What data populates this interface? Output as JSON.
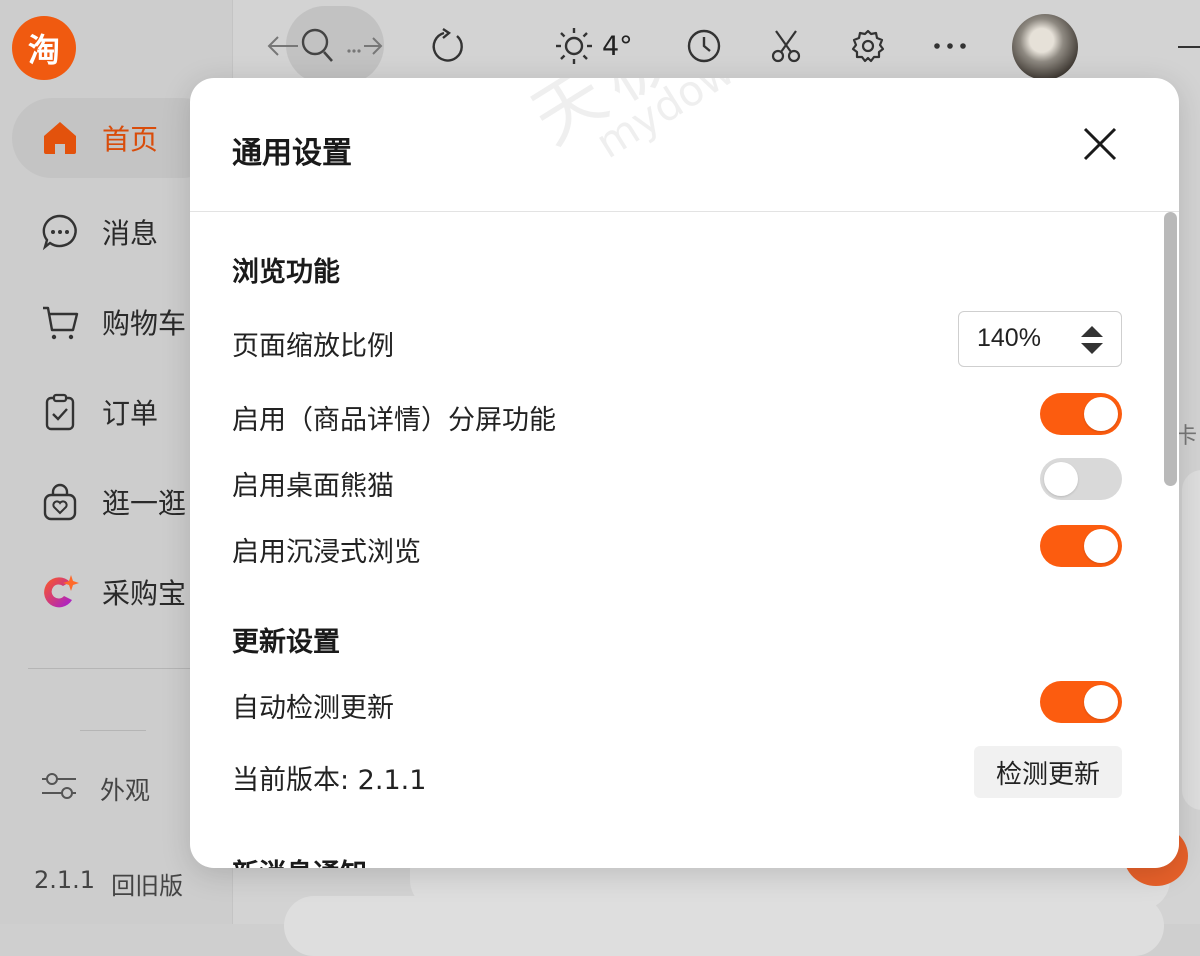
{
  "sidebar": {
    "logo_text": "淘",
    "items": [
      {
        "label": "首页",
        "icon": "home-icon",
        "active": true
      },
      {
        "label": "消息",
        "icon": "message-icon"
      },
      {
        "label": "购物车",
        "icon": "cart-icon"
      },
      {
        "label": "订单",
        "icon": "order-icon"
      },
      {
        "label": "逛一逛",
        "icon": "browse-bag-icon"
      },
      {
        "label": "采购宝",
        "icon": "caigoubao-icon"
      }
    ],
    "appearance_label": "外观",
    "version_text": "2.1.1",
    "old_version_label": "回旧版"
  },
  "topbar": {
    "weather_temp": "4°",
    "icons": [
      "back-icon",
      "search-icon",
      "more-dots-icon",
      "forward-icon",
      "refresh-icon",
      "sun-icon",
      "clock-icon",
      "scissors-icon",
      "gear-icon",
      "more-icon",
      "avatar",
      "minimize-icon"
    ]
  },
  "background": {
    "edge_text": "卡"
  },
  "modal": {
    "title": "通用设置",
    "sections": {
      "browse": {
        "title": "浏览功能",
        "zoom_label": "页面缩放比例",
        "zoom_value": "140%",
        "split_label": "启用（商品详情）分屏功能",
        "split_on": true,
        "panda_label": "启用桌面熊猫",
        "panda_on": false,
        "immersive_label": "启用沉浸式浏览",
        "immersive_on": true
      },
      "update": {
        "title": "更新设置",
        "auto_label": "自动检测更新",
        "auto_on": true,
        "version_label": "当前版本: 2.1.1",
        "check_button": "检测更新"
      },
      "notify": {
        "title": "新消息通知"
      }
    },
    "colors": {
      "toggle_on": "#fc5c0f",
      "toggle_off": "#d9d9d9"
    }
  },
  "watermark": {
    "main": "天极下载站",
    "sub": "mydown.yesky.com"
  }
}
